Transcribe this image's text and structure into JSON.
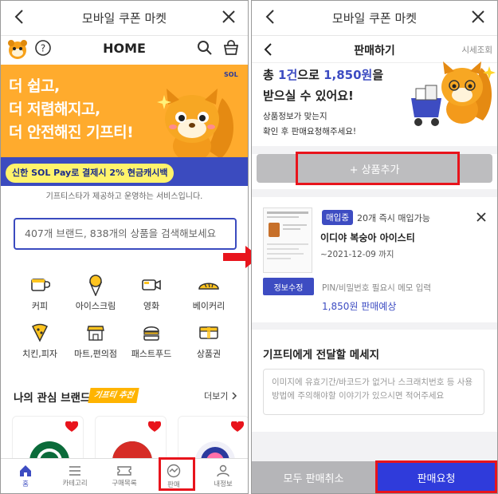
{
  "left": {
    "appbar_title": "모바일 쿠폰 마켓",
    "home_title": "HOME",
    "banner": {
      "line1": "더 쉽고,",
      "line2": "더 저렴해지고,",
      "line3": "더 안전해진 기프티!",
      "promo": "신한 SOL Pay로 결제시 2% 현금캐시백",
      "logo": "SOL"
    },
    "sub_info": "기프티스타가 제공하고 운영하는 서비스입니다.",
    "search_placeholder": "407개 브랜드, 838개의 상품을 검색해보세요",
    "categories": [
      {
        "label": "커피",
        "icon": "coffee-cup-icon"
      },
      {
        "label": "아이스크림",
        "icon": "ice-cream-icon"
      },
      {
        "label": "영화",
        "icon": "movie-camera-icon"
      },
      {
        "label": "베이커리",
        "icon": "bread-icon"
      },
      {
        "label": "치킨,피자",
        "icon": "pizza-slice-icon"
      },
      {
        "label": "마트,편의점",
        "icon": "store-icon"
      },
      {
        "label": "패스트푸드",
        "icon": "burger-icon"
      },
      {
        "label": "상품권",
        "icon": "gift-card-icon"
      }
    ],
    "brands_title": "나의 관심 브랜드",
    "brands_tag": "기프티 추천",
    "more": "더보기",
    "tabs": [
      {
        "label": "홈",
        "icon": "home-icon"
      },
      {
        "label": "카테고리",
        "icon": "menu-icon"
      },
      {
        "label": "구매목록",
        "icon": "ticket-icon"
      },
      {
        "label": "판매",
        "icon": "sell-icon"
      },
      {
        "label": "내정보",
        "icon": "person-icon"
      }
    ]
  },
  "right": {
    "appbar_title": "모바일 쿠폰 마켓",
    "sell_title": "판매하기",
    "market_price": "시세조회",
    "headline_prefix": "총 ",
    "headline_count": "1건",
    "headline_mid": "으로 ",
    "headline_amount": "1,850원",
    "headline_suffix": "을",
    "headline_line2": "받으실 수 있어요!",
    "notice1": "상품정보가 맞는지",
    "notice2": "확인 후 판매요청해주세요!",
    "add_button": "+ 상품추가",
    "item": {
      "badge": "매입중",
      "instant": "20개 즉시 매입가능",
      "name": "이디야 복숭아 아이스티",
      "expiry": "~2021-12-09 까지",
      "edit": "정보수정",
      "pin_note": "PIN/비밀번호 필요시 메모 입력",
      "expected": "1,850원 판매예상"
    },
    "message_title": "기프티에게 전달할 메세지",
    "message_placeholder": "이미지에 유효기간/바코드가 없거나 스크래치번호 등 사용방법에 주의해야할 이야기가 있으시면 적어주세요",
    "cancel_all": "모두 판매취소",
    "submit": "판매요청"
  },
  "colors": {
    "accent": "#3d4cc2",
    "highlight": "#e8141c",
    "banner": "#ffab2d",
    "disabled": "#bdbdbf"
  }
}
